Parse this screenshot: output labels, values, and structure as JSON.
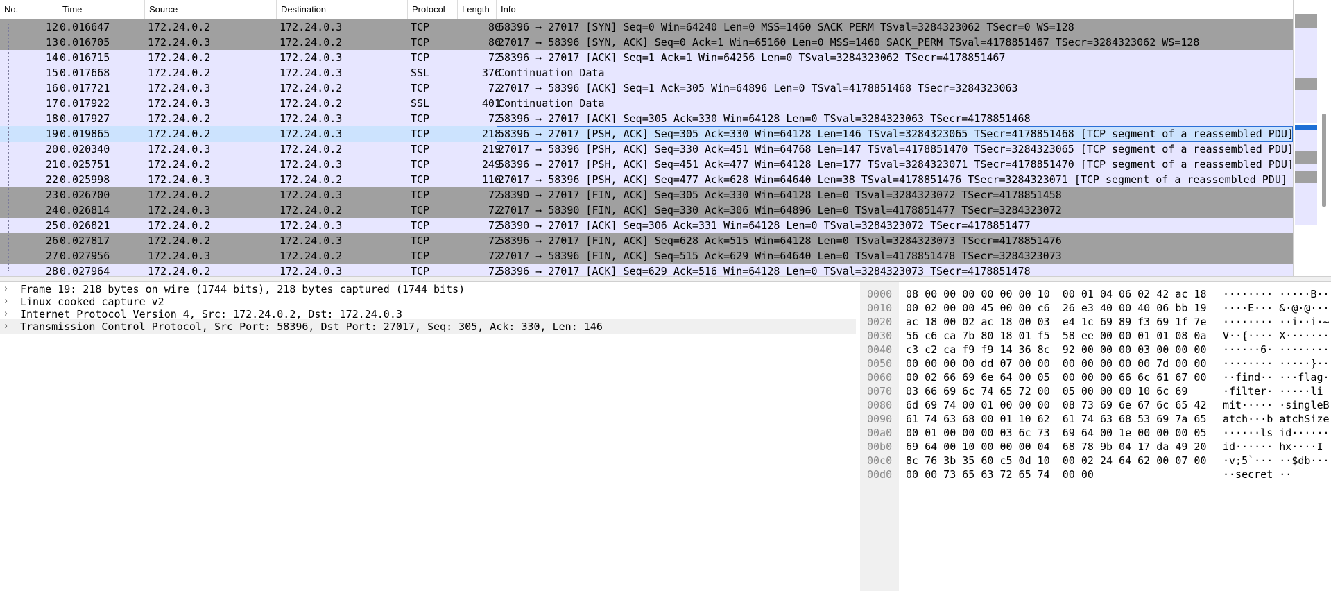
{
  "columns": {
    "no": "No.",
    "time": "Time",
    "source": "Source",
    "destination": "Destination",
    "protocol": "Protocol",
    "length": "Length",
    "info": "Info"
  },
  "packets": [
    {
      "no": "12",
      "time": "0.016647",
      "src": "172.24.0.2",
      "dst": "172.24.0.3",
      "proto": "TCP",
      "len": "80",
      "info": "58396 → 27017 [SYN] Seq=0 Win=64240 Len=0 MSS=1460 SACK_PERM TSval=3284323062 TSecr=0 WS=128",
      "style": "dark"
    },
    {
      "no": "13",
      "time": "0.016705",
      "src": "172.24.0.3",
      "dst": "172.24.0.2",
      "proto": "TCP",
      "len": "80",
      "info": "27017 → 58396 [SYN, ACK] Seq=0 Ack=1 Win=65160 Len=0 MSS=1460 SACK_PERM TSval=4178851467 TSecr=3284323062 WS=128",
      "style": "dark"
    },
    {
      "no": "14",
      "time": "0.016715",
      "src": "172.24.0.2",
      "dst": "172.24.0.3",
      "proto": "TCP",
      "len": "72",
      "info": "58396 → 27017 [ACK] Seq=1 Ack=1 Win=64256 Len=0 TSval=3284323062 TSecr=4178851467",
      "style": "light"
    },
    {
      "no": "15",
      "time": "0.017668",
      "src": "172.24.0.2",
      "dst": "172.24.0.3",
      "proto": "SSL",
      "len": "376",
      "info": "Continuation Data",
      "style": "light"
    },
    {
      "no": "16",
      "time": "0.017721",
      "src": "172.24.0.3",
      "dst": "172.24.0.2",
      "proto": "TCP",
      "len": "72",
      "info": "27017 → 58396 [ACK] Seq=1 Ack=305 Win=64896 Len=0 TSval=4178851468 TSecr=3284323063",
      "style": "light"
    },
    {
      "no": "17",
      "time": "0.017922",
      "src": "172.24.0.3",
      "dst": "172.24.0.2",
      "proto": "SSL",
      "len": "401",
      "info": "Continuation Data",
      "style": "light"
    },
    {
      "no": "18",
      "time": "0.017927",
      "src": "172.24.0.2",
      "dst": "172.24.0.3",
      "proto": "TCP",
      "len": "72",
      "info": "58396 → 27017 [ACK] Seq=305 Ack=330 Win=64128 Len=0 TSval=3284323063 TSecr=4178851468",
      "style": "light"
    },
    {
      "no": "19",
      "time": "0.019865",
      "src": "172.24.0.2",
      "dst": "172.24.0.3",
      "proto": "TCP",
      "len": "218",
      "info": "58396 → 27017 [PSH, ACK] Seq=305 Ack=330 Win=64128 Len=146 TSval=3284323065 TSecr=4178851468 [TCP segment of a reassembled PDU]",
      "style": "sel"
    },
    {
      "no": "20",
      "time": "0.020340",
      "src": "172.24.0.3",
      "dst": "172.24.0.2",
      "proto": "TCP",
      "len": "219",
      "info": "27017 → 58396 [PSH, ACK] Seq=330 Ack=451 Win=64768 Len=147 TSval=4178851470 TSecr=3284323065 [TCP segment of a reassembled PDU]",
      "style": "light"
    },
    {
      "no": "21",
      "time": "0.025751",
      "src": "172.24.0.2",
      "dst": "172.24.0.3",
      "proto": "TCP",
      "len": "249",
      "info": "58396 → 27017 [PSH, ACK] Seq=451 Ack=477 Win=64128 Len=177 TSval=3284323071 TSecr=4178851470 [TCP segment of a reassembled PDU]",
      "style": "light"
    },
    {
      "no": "22",
      "time": "0.025998",
      "src": "172.24.0.3",
      "dst": "172.24.0.2",
      "proto": "TCP",
      "len": "110",
      "info": "27017 → 58396 [PSH, ACK] Seq=477 Ack=628 Win=64640 Len=38 TSval=4178851476 TSecr=3284323071 [TCP segment of a reassembled PDU]",
      "style": "light"
    },
    {
      "no": "23",
      "time": "0.026700",
      "src": "172.24.0.2",
      "dst": "172.24.0.3",
      "proto": "TCP",
      "len": "72",
      "info": "58390 → 27017 [FIN, ACK] Seq=305 Ack=330 Win=64128 Len=0 TSval=3284323072 TSecr=4178851458",
      "style": "dark"
    },
    {
      "no": "24",
      "time": "0.026814",
      "src": "172.24.0.3",
      "dst": "172.24.0.2",
      "proto": "TCP",
      "len": "72",
      "info": "27017 → 58390 [FIN, ACK] Seq=330 Ack=306 Win=64896 Len=0 TSval=4178851477 TSecr=3284323072",
      "style": "dark"
    },
    {
      "no": "25",
      "time": "0.026821",
      "src": "172.24.0.2",
      "dst": "172.24.0.3",
      "proto": "TCP",
      "len": "72",
      "info": "58390 → 27017 [ACK] Seq=306 Ack=331 Win=64128 Len=0 TSval=3284323072 TSecr=4178851477",
      "style": "light"
    },
    {
      "no": "26",
      "time": "0.027817",
      "src": "172.24.0.2",
      "dst": "172.24.0.3",
      "proto": "TCP",
      "len": "72",
      "info": "58396 → 27017 [FIN, ACK] Seq=628 Ack=515 Win=64128 Len=0 TSval=3284323073 TSecr=4178851476",
      "style": "dark"
    },
    {
      "no": "27",
      "time": "0.027956",
      "src": "172.24.0.3",
      "dst": "172.24.0.2",
      "proto": "TCP",
      "len": "72",
      "info": "27017 → 58396 [FIN, ACK] Seq=515 Ack=629 Win=64640 Len=0 TSval=4178851478 TSecr=3284323073",
      "style": "dark"
    },
    {
      "no": "28",
      "time": "0.027964",
      "src": "172.24.0.2",
      "dst": "172.24.0.3",
      "proto": "TCP",
      "len": "72",
      "info": "58396 → 27017 [ACK] Seq=629 Ack=516 Win=64128 Len=0 TSval=3284323073 TSecr=4178851478",
      "style": "light"
    }
  ],
  "details": [
    "Frame 19: 218 bytes on wire (1744 bits), 218 bytes captured (1744 bits)",
    "Linux cooked capture v2",
    "Internet Protocol Version 4, Src: 172.24.0.2, Dst: 172.24.0.3",
    "Transmission Control Protocol, Src Port: 58396, Dst Port: 27017, Seq: 305, Ack: 330, Len: 146"
  ],
  "hex": [
    {
      "off": "0000",
      "bytes": "08 00 00 00 00 00 00 10  00 01 04 06 02 42 ac 18",
      "ascii": "········ ·····B··"
    },
    {
      "off": "0010",
      "bytes": "00 02 00 00 45 00 00 c6  26 e3 40 00 40 06 bb 19",
      "ascii": "····E··· &·@·@···"
    },
    {
      "off": "0020",
      "bytes": "ac 18 00 02 ac 18 00 03  e4 1c 69 89 f3 69 1f 7e",
      "ascii": "········ ··i··i·~"
    },
    {
      "off": "0030",
      "bytes": "56 c6 ca 7b 80 18 01 f5  58 ee 00 00 01 01 08 0a",
      "ascii": "V··{···· X·······"
    },
    {
      "off": "0040",
      "bytes": "c3 c2 ca f9 f9 14 36 8c  92 00 00 00 03 00 00 00",
      "ascii": "······6· ········"
    },
    {
      "off": "0050",
      "bytes": "00 00 00 00 dd 07 00 00  00 00 00 00 00 7d 00 00",
      "ascii": "········ ·····}··"
    },
    {
      "off": "0060",
      "bytes": "00 02 66 69 6e 64 00 05  00 00 00 66 6c 61 67 00",
      "ascii": "··find·· ···flag·"
    },
    {
      "off": "0070",
      "bytes": "03 66 69 6c 74 65 72 00  05 00 00 00 10 6c 69",
      "ascii": "·filter· ·····li"
    },
    {
      "off": "0080",
      "bytes": "6d 69 74 00 01 00 00 00  08 73 69 6e 67 6c 65 42",
      "ascii": "mit····· ·singleB"
    },
    {
      "off": "0090",
      "bytes": "61 74 63 68 00 01 10 62  61 74 63 68 53 69 7a 65",
      "ascii": "atch···b atchSize"
    },
    {
      "off": "00a0",
      "bytes": "00 01 00 00 00 03 6c 73  69 64 00 1e 00 00 00 05",
      "ascii": "······ls id······"
    },
    {
      "off": "00b0",
      "bytes": "69 64 00 10 00 00 00 04  68 78 9b 04 17 da 49 20",
      "ascii": "id······ hx····I "
    },
    {
      "off": "00c0",
      "bytes": "8c 76 3b 35 60 c5 0d 10  00 02 24 64 62 00 07 00",
      "ascii": "·v;5`··· ··$db···"
    },
    {
      "off": "00d0",
      "bytes": "00 00 73 65 63 72 65 74  00 00",
      "ascii": "··secret ··"
    }
  ],
  "colors": {
    "row_dark": "#a0a0a0",
    "row_light": "#e7e6ff",
    "row_selected": "#cce3fe",
    "selection_outline": "#2a6fd6"
  }
}
